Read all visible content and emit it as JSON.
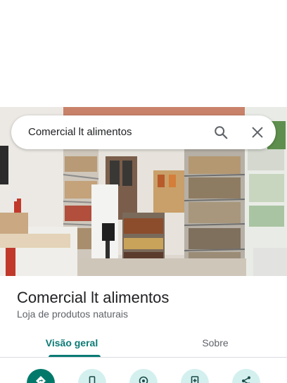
{
  "search": {
    "query": "Comercial lt alimentos",
    "search_icon": "search-icon",
    "close_icon": "close-icon"
  },
  "place": {
    "name": "Comercial lt alimentos",
    "category": "Loja de produtos naturais"
  },
  "tabs": [
    {
      "label": "Visão geral",
      "selected": true
    },
    {
      "label": "Sobre",
      "selected": false
    }
  ],
  "actions": [
    {
      "icon": "directions-icon"
    },
    {
      "icon": "phone-icon"
    },
    {
      "icon": "location-icon"
    },
    {
      "icon": "save-icon"
    },
    {
      "icon": "share-icon"
    }
  ],
  "colors": {
    "accent": "#0a7a75",
    "action_bg": "#d3f0ef",
    "primary_action": "#00796b"
  }
}
